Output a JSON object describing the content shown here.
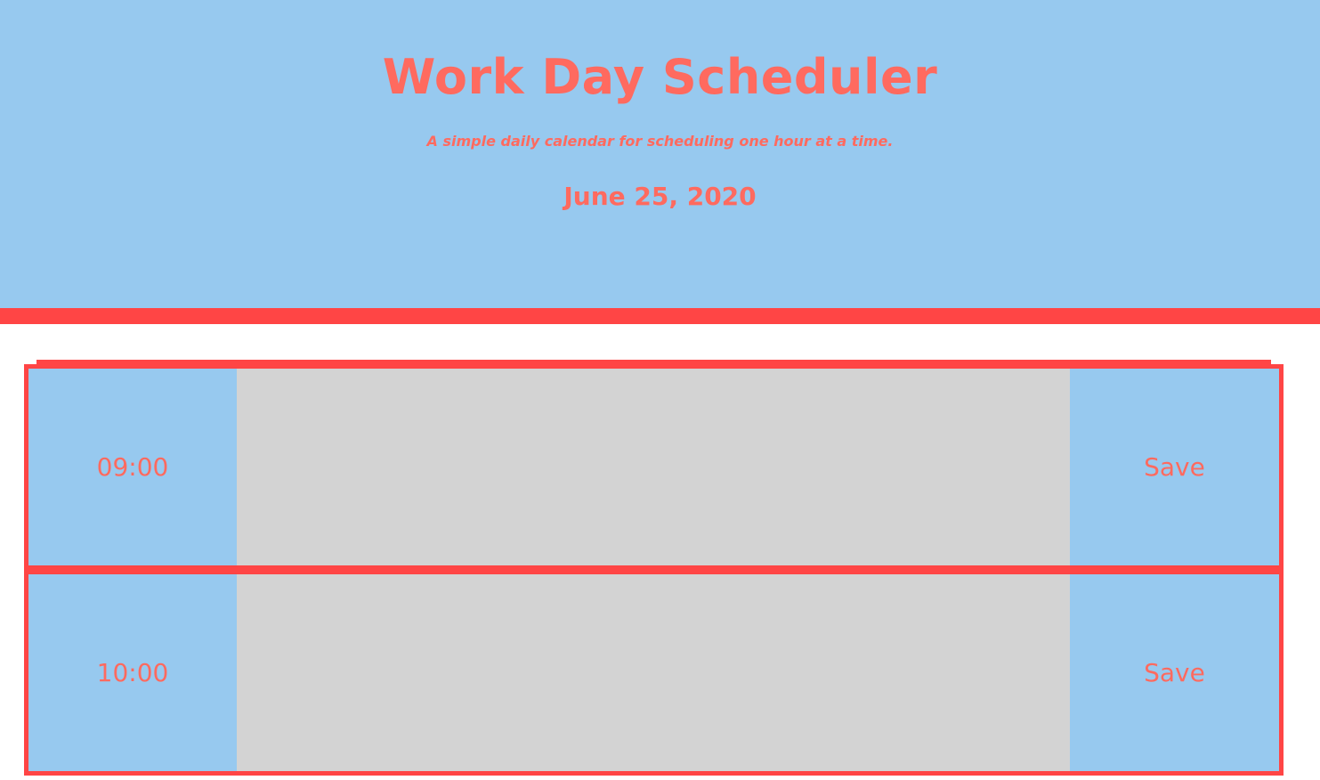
{
  "header": {
    "title": "Work Day Scheduler",
    "subtitle": "A simple daily calendar for scheduling one hour at a time.",
    "date": "June 25, 2020"
  },
  "schedule": {
    "rows": [
      {
        "hour": "09:00",
        "entry": "",
        "save_label": "Save"
      },
      {
        "hour": "10:00",
        "entry": "",
        "save_label": "Save"
      }
    ]
  },
  "colors": {
    "header_bg": "#97c9ef",
    "accent_red": "#ff4545",
    "text_coral": "#ff6a5f",
    "entry_bg": "#d3d3d3"
  }
}
